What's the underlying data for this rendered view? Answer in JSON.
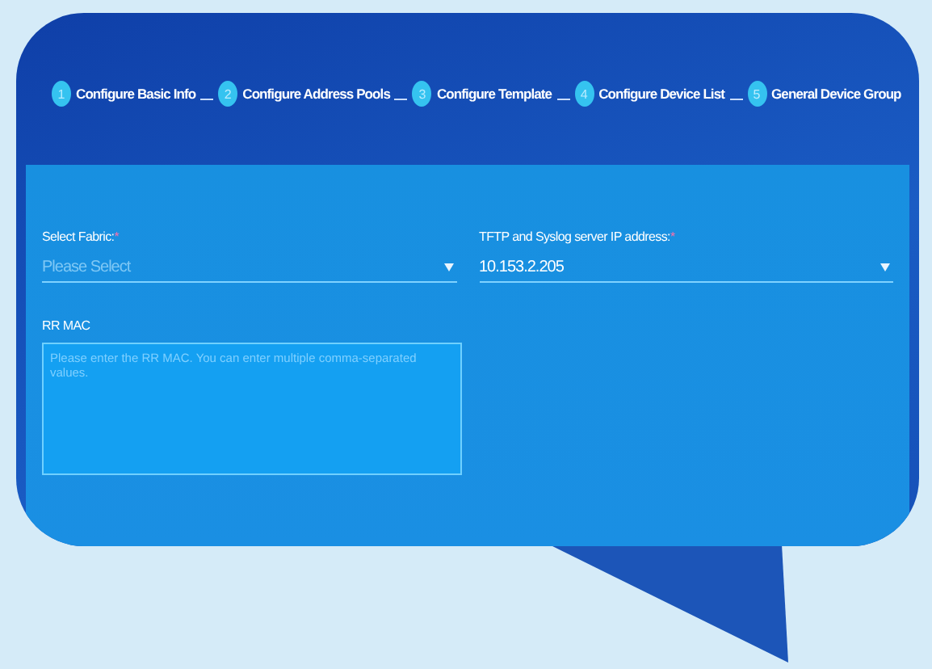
{
  "steps": [
    {
      "number": "1",
      "label": "Configure Basic Info"
    },
    {
      "number": "2",
      "label": "Configure Address Pools"
    },
    {
      "number": "3",
      "label": "Configure Template"
    },
    {
      "number": "4",
      "label": "Configure Device List"
    },
    {
      "number": "5",
      "label": "General Device Group"
    }
  ],
  "form": {
    "fabric": {
      "label": "Select Fabric:",
      "required_mark": "*",
      "placeholder": "Please Select"
    },
    "server_ip": {
      "label": "TFTP and Syslog server IP address:",
      "required_mark": "*",
      "value": "10.153.2.205"
    },
    "rr_mac": {
      "label": "RR MAC",
      "placeholder": "Please enter the RR MAC. You can enter multiple comma-separated values."
    }
  }
}
